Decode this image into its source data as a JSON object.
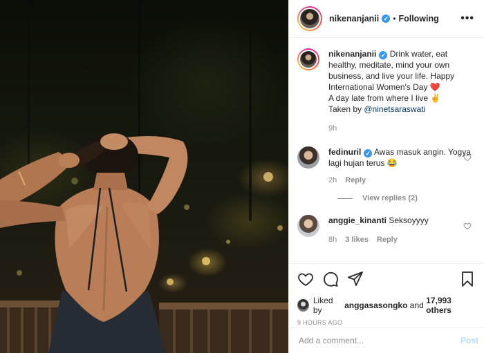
{
  "post": {
    "username": "nikenanjanii",
    "follow_status": "Following",
    "more": "•••",
    "caption": {
      "line1": "Drink water, eat healthy, meditate, mind your own business, and live your life. Happy International Women's Day",
      "heart": "❤️",
      "line2": "A day late from where I live",
      "hand": "✌",
      "line3_prefix": "Taken by",
      "mention": "@ninetsaraswati",
      "time": "9h"
    }
  },
  "comments": [
    {
      "username": "fedinuril",
      "text": "Awas masuk angin. Yogya lagi hujan terus",
      "emoji": "😂",
      "time": "2h",
      "reply": "Reply",
      "view_replies": "View replies (2)"
    },
    {
      "username": "anggie_kinanti",
      "text": "Seksoyyyy",
      "time": "8h",
      "likes": "3 likes",
      "reply": "Reply"
    }
  ],
  "likes": {
    "prefix": "Liked by",
    "user": "anggasasongko",
    "mid": "and",
    "others": "17,993 others"
  },
  "timestamp": "9 HOURS AGO",
  "add_comment": {
    "placeholder": "Add a comment...",
    "post_label": "Post"
  },
  "icons": [
    "heart-icon",
    "comment-icon",
    "share-icon",
    "bookmark-icon",
    "verified-icon"
  ],
  "colors": {
    "verified": "#3897f0",
    "post_disabled": "#b2dffc",
    "meta_gray": "#8e8e8e"
  }
}
